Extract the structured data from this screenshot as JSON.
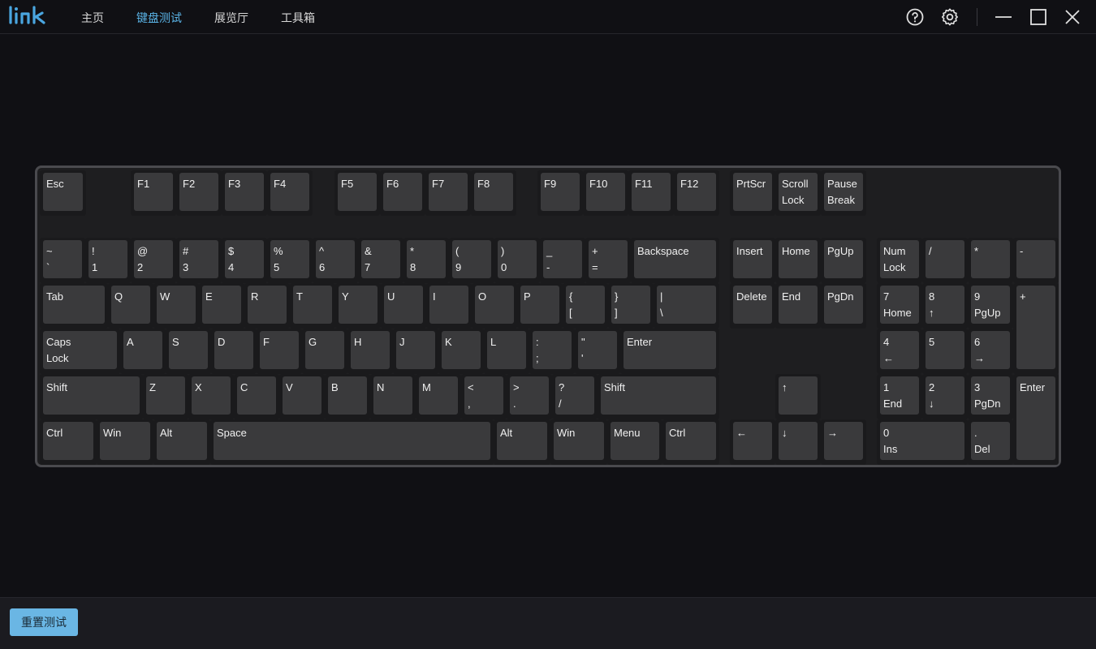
{
  "app": {
    "logo_text": "link"
  },
  "nav": {
    "items": [
      {
        "label": "主页",
        "active": false
      },
      {
        "label": "键盘测试",
        "active": true
      },
      {
        "label": "展览厅",
        "active": false
      },
      {
        "label": "工具箱",
        "active": false
      }
    ]
  },
  "titlebar": {
    "icons": [
      "help-icon",
      "gear-icon",
      "minimize-icon",
      "maximize-icon",
      "close-icon"
    ]
  },
  "colors": {
    "accent": "#5ab3e6",
    "key_face": "#3a3a3c",
    "background": "#101014",
    "button": "#6ab6e4"
  },
  "keyboard": {
    "keys": [
      {
        "l1": "Esc",
        "l2": ""
      },
      {
        "l1": "F1",
        "l2": ""
      },
      {
        "l1": "F2",
        "l2": ""
      },
      {
        "l1": "F3",
        "l2": ""
      },
      {
        "l1": "F4",
        "l2": ""
      },
      {
        "l1": "F5",
        "l2": ""
      },
      {
        "l1": "F6",
        "l2": ""
      },
      {
        "l1": "F7",
        "l2": ""
      },
      {
        "l1": "F8",
        "l2": ""
      },
      {
        "l1": "F9",
        "l2": ""
      },
      {
        "l1": "F10",
        "l2": ""
      },
      {
        "l1": "F11",
        "l2": ""
      },
      {
        "l1": "F12",
        "l2": ""
      },
      {
        "l1": "PrtScr",
        "l2": ""
      },
      {
        "l1": "Scroll",
        "l2": "Lock"
      },
      {
        "l1": "Pause",
        "l2": "Break"
      },
      {
        "l1": "~",
        "l2": "`"
      },
      {
        "l1": "!",
        "l2": "1"
      },
      {
        "l1": "@",
        "l2": "2"
      },
      {
        "l1": "#",
        "l2": "3"
      },
      {
        "l1": "$",
        "l2": "4"
      },
      {
        "l1": "%",
        "l2": "5"
      },
      {
        "l1": "^",
        "l2": "6"
      },
      {
        "l1": "&",
        "l2": "7"
      },
      {
        "l1": "*",
        "l2": "8"
      },
      {
        "l1": "(",
        "l2": "9"
      },
      {
        "l1": ")",
        "l2": "0"
      },
      {
        "l1": "_",
        "l2": "-"
      },
      {
        "l1": "+",
        "l2": "="
      },
      {
        "l1": "Backspace",
        "l2": ""
      },
      {
        "l1": "Insert",
        "l2": ""
      },
      {
        "l1": "Home",
        "l2": ""
      },
      {
        "l1": "PgUp",
        "l2": ""
      },
      {
        "l1": "Num",
        "l2": "Lock"
      },
      {
        "l1": "/",
        "l2": ""
      },
      {
        "l1": "*",
        "l2": ""
      },
      {
        "l1": "-",
        "l2": ""
      },
      {
        "l1": "Tab",
        "l2": ""
      },
      {
        "l1": "Q",
        "l2": ""
      },
      {
        "l1": "W",
        "l2": ""
      },
      {
        "l1": "E",
        "l2": ""
      },
      {
        "l1": "R",
        "l2": ""
      },
      {
        "l1": "T",
        "l2": ""
      },
      {
        "l1": "Y",
        "l2": ""
      },
      {
        "l1": "U",
        "l2": ""
      },
      {
        "l1": "I",
        "l2": ""
      },
      {
        "l1": "O",
        "l2": ""
      },
      {
        "l1": "P",
        "l2": ""
      },
      {
        "l1": "{",
        "l2": "["
      },
      {
        "l1": "}",
        "l2": "]"
      },
      {
        "l1": "|",
        "l2": "\\"
      },
      {
        "l1": "Delete",
        "l2": ""
      },
      {
        "l1": "End",
        "l2": ""
      },
      {
        "l1": "PgDn",
        "l2": ""
      },
      {
        "l1": "7",
        "l2": "Home"
      },
      {
        "l1": "8",
        "l2": "↑"
      },
      {
        "l1": "9",
        "l2": "PgUp"
      },
      {
        "l1": "+",
        "l2": ""
      },
      {
        "l1": "Caps",
        "l2": "Lock"
      },
      {
        "l1": "A",
        "l2": ""
      },
      {
        "l1": "S",
        "l2": ""
      },
      {
        "l1": "D",
        "l2": ""
      },
      {
        "l1": "F",
        "l2": ""
      },
      {
        "l1": "G",
        "l2": ""
      },
      {
        "l1": "H",
        "l2": ""
      },
      {
        "l1": "J",
        "l2": ""
      },
      {
        "l1": "K",
        "l2": ""
      },
      {
        "l1": "L",
        "l2": ""
      },
      {
        "l1": ":",
        "l2": ";"
      },
      {
        "l1": "\"",
        "l2": "'"
      },
      {
        "l1": "Enter",
        "l2": ""
      },
      {
        "l1": "4",
        "l2": "←"
      },
      {
        "l1": "5",
        "l2": ""
      },
      {
        "l1": "6",
        "l2": "→"
      },
      {
        "l1": "Shift",
        "l2": ""
      },
      {
        "l1": "Z",
        "l2": ""
      },
      {
        "l1": "X",
        "l2": ""
      },
      {
        "l1": "C",
        "l2": ""
      },
      {
        "l1": "V",
        "l2": ""
      },
      {
        "l1": "B",
        "l2": ""
      },
      {
        "l1": "N",
        "l2": ""
      },
      {
        "l1": "M",
        "l2": ""
      },
      {
        "l1": "<",
        "l2": ","
      },
      {
        "l1": ">",
        "l2": "."
      },
      {
        "l1": "?",
        "l2": "/"
      },
      {
        "l1": "Shift",
        "l2": ""
      },
      {
        "l1": "↑",
        "l2": ""
      },
      {
        "l1": "1",
        "l2": "End"
      },
      {
        "l1": "2",
        "l2": "↓"
      },
      {
        "l1": "3",
        "l2": "PgDn"
      },
      {
        "l1": "Enter",
        "l2": ""
      },
      {
        "l1": "Ctrl",
        "l2": ""
      },
      {
        "l1": "Win",
        "l2": ""
      },
      {
        "l1": "Alt",
        "l2": ""
      },
      {
        "l1": "Space",
        "l2": ""
      },
      {
        "l1": "Alt",
        "l2": ""
      },
      {
        "l1": "Win",
        "l2": ""
      },
      {
        "l1": "Menu",
        "l2": ""
      },
      {
        "l1": "Ctrl",
        "l2": ""
      },
      {
        "l1": "←",
        "l2": ""
      },
      {
        "l1": "↓",
        "l2": ""
      },
      {
        "l1": "→",
        "l2": ""
      },
      {
        "l1": "0",
        "l2": "Ins"
      },
      {
        "l1": ".",
        "l2": "Del"
      }
    ]
  },
  "footer": {
    "reset_label": "重置测试"
  }
}
